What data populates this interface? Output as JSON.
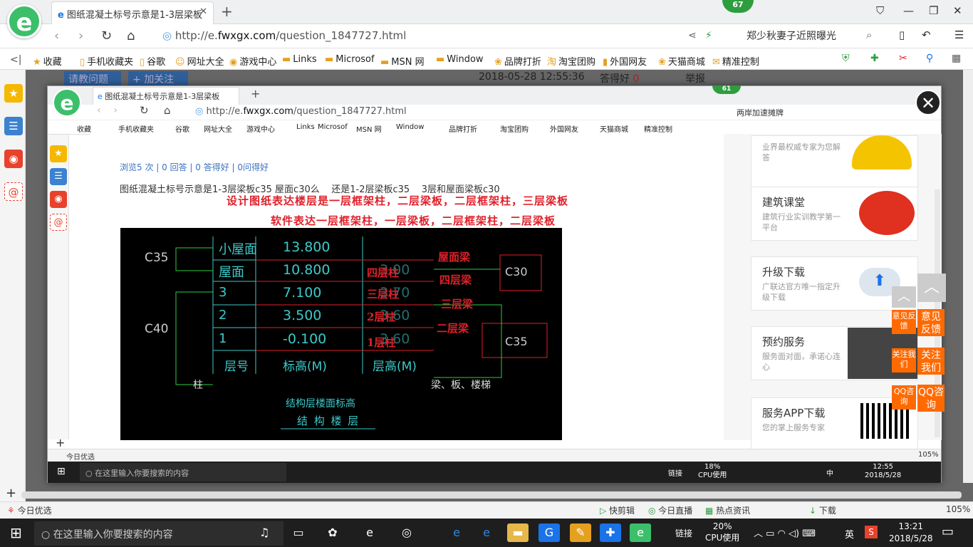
{
  "outer_browser": {
    "tab_title": "图纸混凝土标号示意是1-3层梁板",
    "badge_count": "67",
    "url_prefix": "http://e.",
    "url_domain": "fwxgx.com",
    "url_path": "/question_1847727.html",
    "search_text": "郑少秋妻子近照曝光",
    "bookmarks": [
      "收藏",
      "手机收藏夹",
      "谷歌",
      "网址大全",
      "游戏中心",
      "Links",
      "Microsof",
      "MSN 网",
      "Window",
      "品牌打折",
      "淘宝团购",
      "外国网友",
      "天猫商城",
      "精准控制"
    ],
    "behind_date": "2018-05-28 12:55:36",
    "behind_answer": "答得好",
    "behind_answer_count": "0",
    "behind_report": "举报",
    "behind_btn1": "请教问题",
    "behind_btn2": "加关注"
  },
  "inner_browser": {
    "tab_title": "图纸混凝土标号示意是1-3层梁板",
    "badge_count": "61",
    "url_prefix": "http://e.",
    "url_domain": "fwxgx.com",
    "url_path": "/question_1847727.html",
    "search_text": "两岸加速摊牌",
    "bookmarks": [
      "收藏",
      "手机收藏夹",
      "谷歌",
      "网址大全",
      "游戏中心",
      "Links",
      "Microsof",
      "MSN 网",
      "Window",
      "品牌打折",
      "淘宝团购",
      "外国网友",
      "天猫商城",
      "精准控制"
    ]
  },
  "question": {
    "stats": "浏览5 次 | 0 回答 | 0 答得好 | 0问得好",
    "text": "图纸混凝土标号示意是1-3层梁板c35 屋面c30么    还是1-2层梁板c35    3层和屋面梁板c30",
    "red_line1": "设计图纸表达楼层是一层框架柱，二层梁板，二层框架柱，三层梁板",
    "red_line2": "软件表达一层框架柱，一层梁板，二层框架柱，二层梁板"
  },
  "cad": {
    "label_c35_left": "C35",
    "label_c40": "C40",
    "label_c30": "C30",
    "label_c35_right": "C35",
    "rows": [
      {
        "floor": "小屋面",
        "elev": "13.800",
        "height": ""
      },
      {
        "floor": "屋面",
        "elev": "10.800",
        "height": "3.00"
      },
      {
        "floor": "3",
        "elev": "7.100",
        "height": "3.70"
      },
      {
        "floor": "2",
        "elev": "3.500",
        "height": "3.60"
      },
      {
        "floor": "1",
        "elev": "-0.100",
        "height": "3.60"
      }
    ],
    "header": {
      "floor": "层号",
      "elev": "标高(M)",
      "height": "层高(M)"
    },
    "col_label": "柱",
    "beam_label": "梁、板、楼梯",
    "caption1": "结构层楼面标高",
    "caption2": "结 构 楼 层",
    "red_col_labels": [
      "四层柱",
      "三层柱",
      "2层柱",
      "1层柱"
    ],
    "red_beam_labels": [
      "屋面梁",
      "四层梁",
      "三层梁",
      "二层梁"
    ]
  },
  "right_cards": [
    {
      "title": "",
      "desc": "业界最权威专家为您解答"
    },
    {
      "title": "建筑课堂",
      "desc": "建筑行业实训教学第一平台"
    },
    {
      "title": "升级下载",
      "desc": "广联达官方唯一指定升级下载"
    },
    {
      "title": "预约服务",
      "desc": "服务面对面，承诺心连心"
    },
    {
      "title": "服务APP下载",
      "desc": "您的掌上服务专家"
    }
  ],
  "float_buttons": [
    "意见反馈",
    "关注我们",
    "QQ咨询"
  ],
  "status_bar": {
    "left": "今日优选",
    "items": [
      "快剪辑",
      "今日直播",
      "热点资讯",
      "下载"
    ],
    "zoom": "105%"
  },
  "taskbar": {
    "search_placeholder": "在这里输入你要搜索的内容",
    "link_label": "链接",
    "cpu_percent": "20%",
    "cpu_label": "CPU使用",
    "ime": "英",
    "time": "13:21",
    "date": "2018/5/28"
  },
  "inner_taskbar": {
    "search_placeholder": "在这里输入你要搜索的内容",
    "link_label": "链接",
    "cpu_percent": "18%",
    "cpu_label": "CPU使用",
    "ime": "中",
    "time": "12:55",
    "date": "2018/5/28",
    "status_left": "今日优选",
    "zoom": "105%"
  },
  "colors": {
    "accent_green": "#3cbf6a",
    "orange": "#ff6a00",
    "red_text": "#e0202a",
    "cad_cyan": "#3ec9c9"
  }
}
